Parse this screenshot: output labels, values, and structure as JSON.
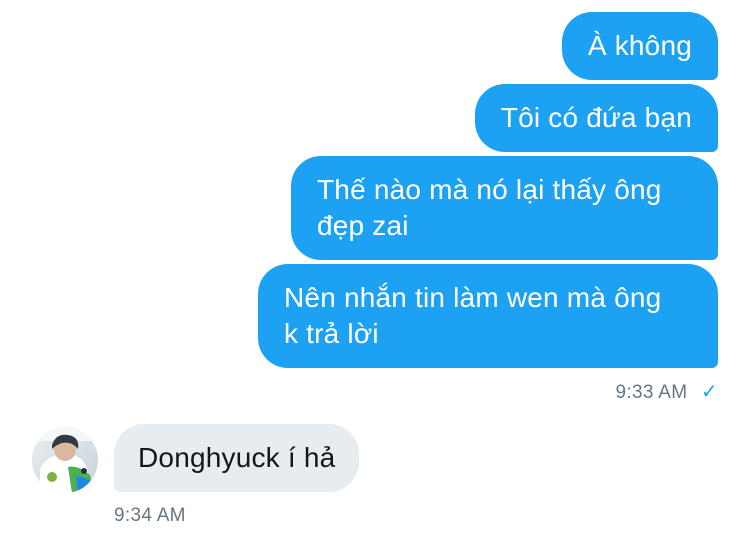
{
  "messages": {
    "outgoing": [
      {
        "text": "À không"
      },
      {
        "text": "Tôi có đứa bạn"
      },
      {
        "text": "Thế nào mà nó lại thấy ông\nđẹp zai"
      },
      {
        "text": "Nên nhắn tin làm wen mà ông\nk trả lời"
      }
    ],
    "outgoing_time": "9:33 AM",
    "read_check": "✓",
    "incoming": [
      {
        "text": "Donghyuck í hả"
      }
    ],
    "incoming_time": "9:34 AM",
    "avatar_icon": "user-avatar-photo"
  },
  "colors": {
    "outgoing_bubble": "#1da1f2",
    "incoming_bubble": "#e6ecf0",
    "meta_text": "#657786",
    "check": "#1da1f2"
  }
}
